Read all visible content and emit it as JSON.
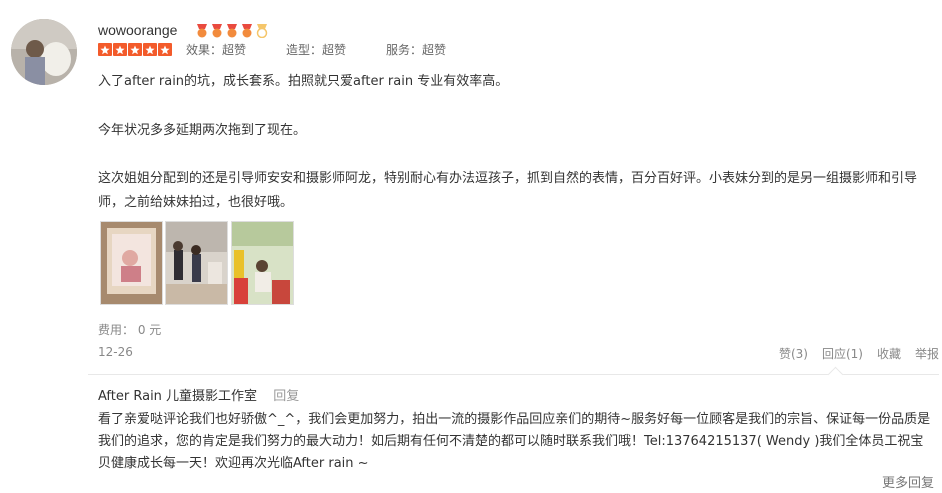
{
  "review": {
    "username": "wowoorange",
    "ratings": [
      {
        "label": "效果：超赞"
      },
      {
        "label": "造型：超赞"
      },
      {
        "label": "服务：超赞"
      }
    ],
    "paragraphs": [
      "入了after rain的坑，成长套系。拍照就只爱after rain 专业有效率高。",
      "今年状况多多延期两次拖到了现在。",
      "这次姐姐分配到的还是引导师安安和摄影师阿龙，特别耐心有办法逗孩子，抓到自然的表情，百分百好评。小表妹分到的是另一组摄影师和引导师，之前给妹妹拍过，也很好哦。"
    ],
    "cost": "费用： 0 元",
    "date": "12-26",
    "actions": {
      "like": "赞(3)",
      "reply": "回应(1)",
      "favorite": "收藏",
      "report": "举报"
    }
  },
  "reply": {
    "shop_name": "After Rain 儿童摄影工作室",
    "reply_label": "回复",
    "text": "看了亲爱哒评论我们也好骄傲^_^，我们会更加努力，拍出一流的摄影作品回应亲们的期待~服务好每一位顾客是我们的宗旨、保证每一份品质是我们的追求，您的肯定是我们努力的最大动力！如后期有任何不清楚的都可以随时联系我们哦！Tel:13764215137( Wendy )我们全体员工祝宝贝健康成长每一天！欢迎再次光临After rain ~"
  },
  "more_replies": "更多回复",
  "colors": {
    "star": "#f35b2b",
    "medal": "#f28b3d",
    "text": "#333333",
    "muted": "#888888"
  }
}
